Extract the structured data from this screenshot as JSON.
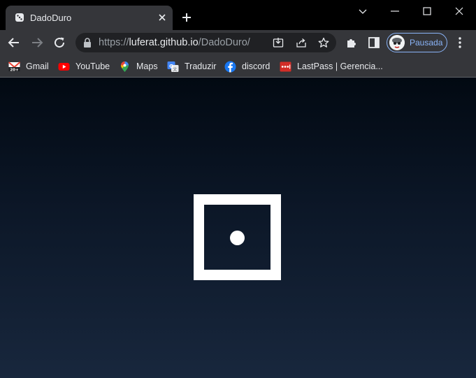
{
  "tab": {
    "title": "DadoDuro"
  },
  "address_bar": {
    "scheme": "https://",
    "host": "luferat.github.io",
    "path": "/DadoDuro/"
  },
  "profile": {
    "label": "Pausada"
  },
  "bookmarks": [
    {
      "label": "Gmail",
      "icon": "gmail-icon"
    },
    {
      "label": "YouTube",
      "icon": "youtube-icon"
    },
    {
      "label": "Maps",
      "icon": "maps-icon"
    },
    {
      "label": "Traduzir",
      "icon": "translate-icon"
    },
    {
      "label": "discord",
      "icon": "facebook-icon"
    },
    {
      "label": "LastPass | Gerencia...",
      "icon": "lastpass-icon"
    }
  ],
  "die": {
    "face_value": 1
  },
  "colors": {
    "accent": "#8ab4f8",
    "page_top": "#020912",
    "page_bottom": "#18273d",
    "die": "#ffffff"
  }
}
